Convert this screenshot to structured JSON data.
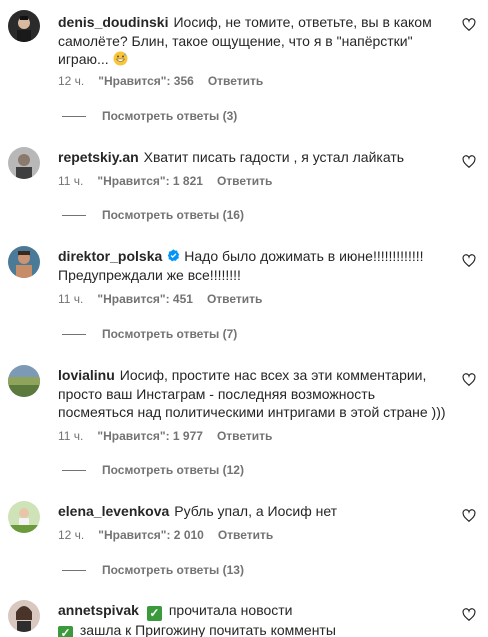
{
  "comments": [
    {
      "username": "denis_doudinski",
      "text": "Иосиф, не томите, ответьте, вы в каком самолёте? Блин, такое ощущение, что я в \"напёрстки\" играю...",
      "time": "12 ч.",
      "likes": "\"Нравится\": 356",
      "reply": "Ответить",
      "view_replies": "Посмотреть ответы (3)"
    },
    {
      "username": "repetskiy.an",
      "text": "Хватит писать гадости , я устал лайкать",
      "time": "11 ч.",
      "likes": "\"Нравится\": 1 821",
      "reply": "Ответить",
      "view_replies": "Посмотреть ответы (16)"
    },
    {
      "username": "direktor_polska",
      "text": "Надо было дожимать в июне!!!!!!!!!!!!! Предупреждали же все!!!!!!!!",
      "time": "11 ч.",
      "likes": "\"Нравится\": 451",
      "reply": "Ответить",
      "view_replies": "Посмотреть ответы (7)"
    },
    {
      "username": "lovialinu",
      "text": "Иосиф, простите нас всех за эти комментарии, просто ваш Инстаграм - последняя возможность посмеяться над политическими интригами в этой стране )))",
      "time": "11 ч.",
      "likes": "\"Нравится\": 1 977",
      "reply": "Ответить",
      "view_replies": "Посмотреть ответы (12)"
    },
    {
      "username": "elena_levenkova",
      "text": "Рубль упал, а Иосиф нет",
      "time": "12 ч.",
      "likes": "\"Нравится\": 2 010",
      "reply": "Ответить",
      "view_replies": "Посмотреть ответы (13)"
    },
    {
      "username": "annetspivak",
      "text_line1": "прочитала новости",
      "text_line2": "зашла к Пригожину почитать комменты"
    }
  ],
  "icons": {
    "like": "heart-outline-icon",
    "verified": "verified-badge-icon",
    "checkbox": "green-check-emoji",
    "laugh": "grinning-sweat-emoji"
  },
  "colors": {
    "verified": "#0095f6",
    "checkbox": "#3a9a3c",
    "meta": "#737373"
  }
}
